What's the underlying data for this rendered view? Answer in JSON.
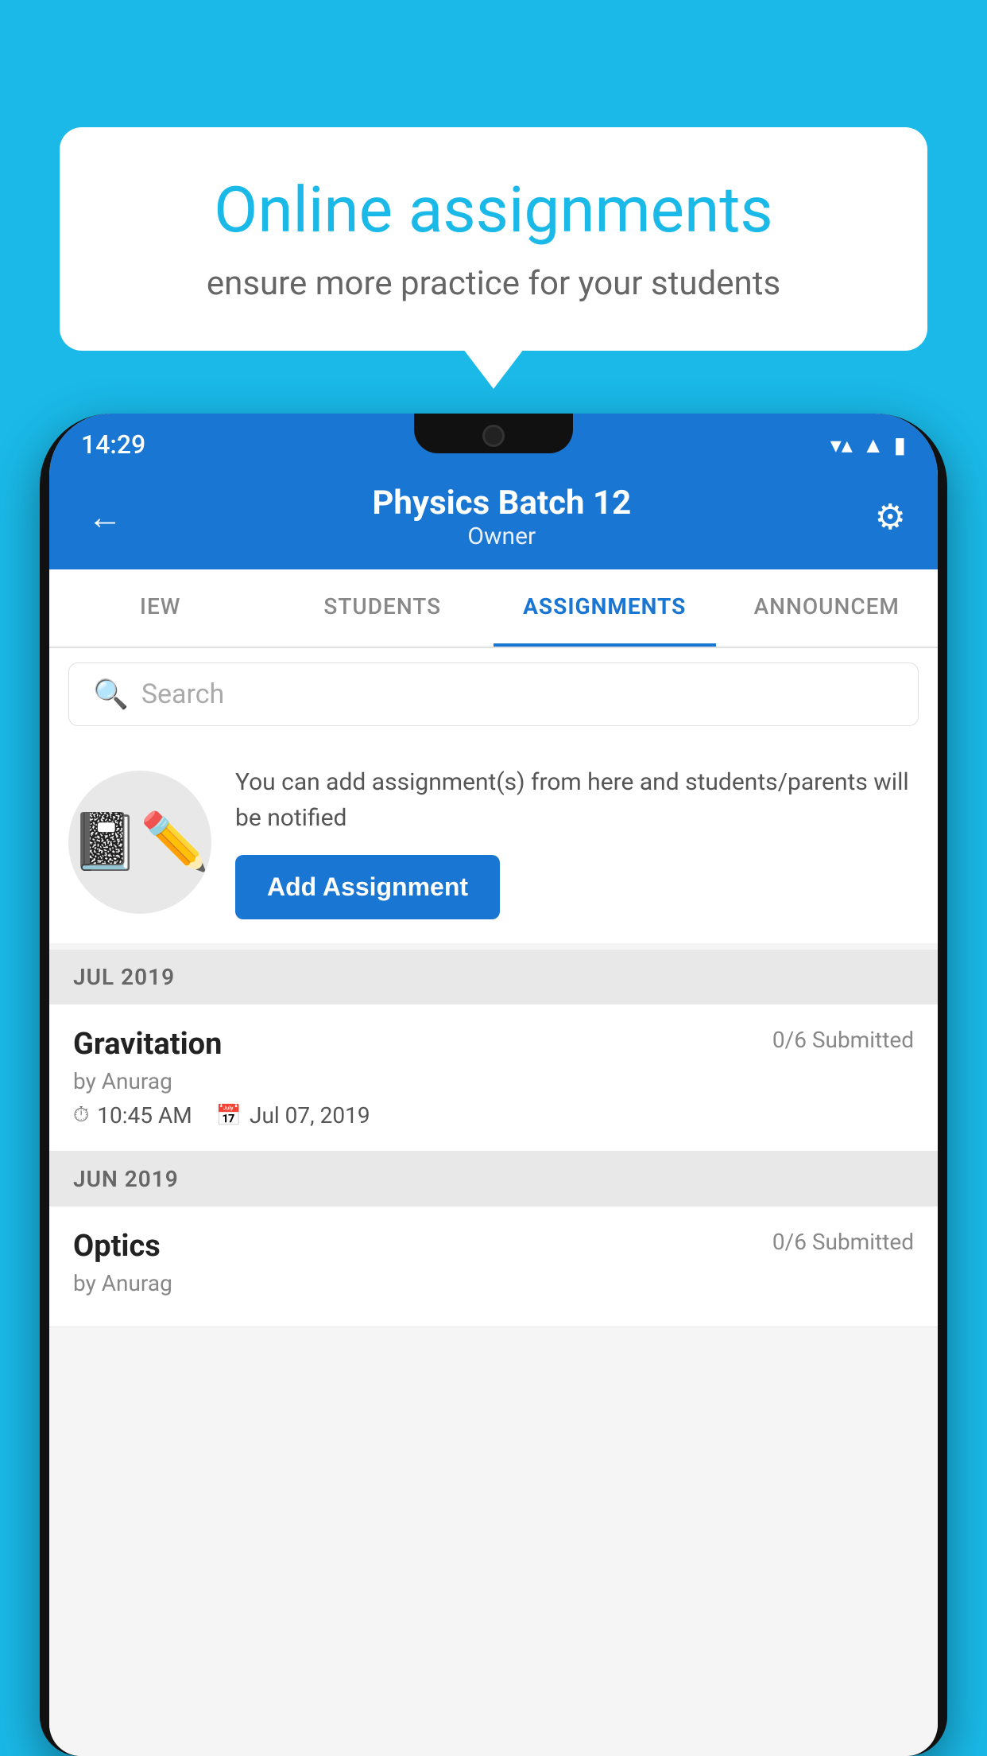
{
  "background_color": "#1ab9e8",
  "speech_bubble": {
    "title": "Online assignments",
    "subtitle": "ensure more practice for your students"
  },
  "status_bar": {
    "time": "14:29",
    "wifi": "▼",
    "signal": "▲",
    "battery": "▮"
  },
  "header": {
    "title": "Physics Batch 12",
    "subtitle": "Owner",
    "back_label": "←",
    "settings_label": "⚙"
  },
  "tabs": [
    {
      "label": "IEW",
      "active": false
    },
    {
      "label": "STUDENTS",
      "active": false
    },
    {
      "label": "ASSIGNMENTS",
      "active": true
    },
    {
      "label": "ANNOUNCEM",
      "active": false
    }
  ],
  "search": {
    "placeholder": "Search"
  },
  "promo": {
    "description": "You can add assignment(s) from here and students/parents will be notified",
    "add_button_label": "Add Assignment"
  },
  "sections": [
    {
      "month_label": "JUL 2019",
      "assignments": [
        {
          "name": "Gravitation",
          "submitted": "0/6 Submitted",
          "author": "by Anurag",
          "time": "10:45 AM",
          "date": "Jul 07, 2019"
        }
      ]
    },
    {
      "month_label": "JUN 2019",
      "assignments": [
        {
          "name": "Optics",
          "submitted": "0/6 Submitted",
          "author": "by Anurag",
          "time": "",
          "date": ""
        }
      ]
    }
  ]
}
